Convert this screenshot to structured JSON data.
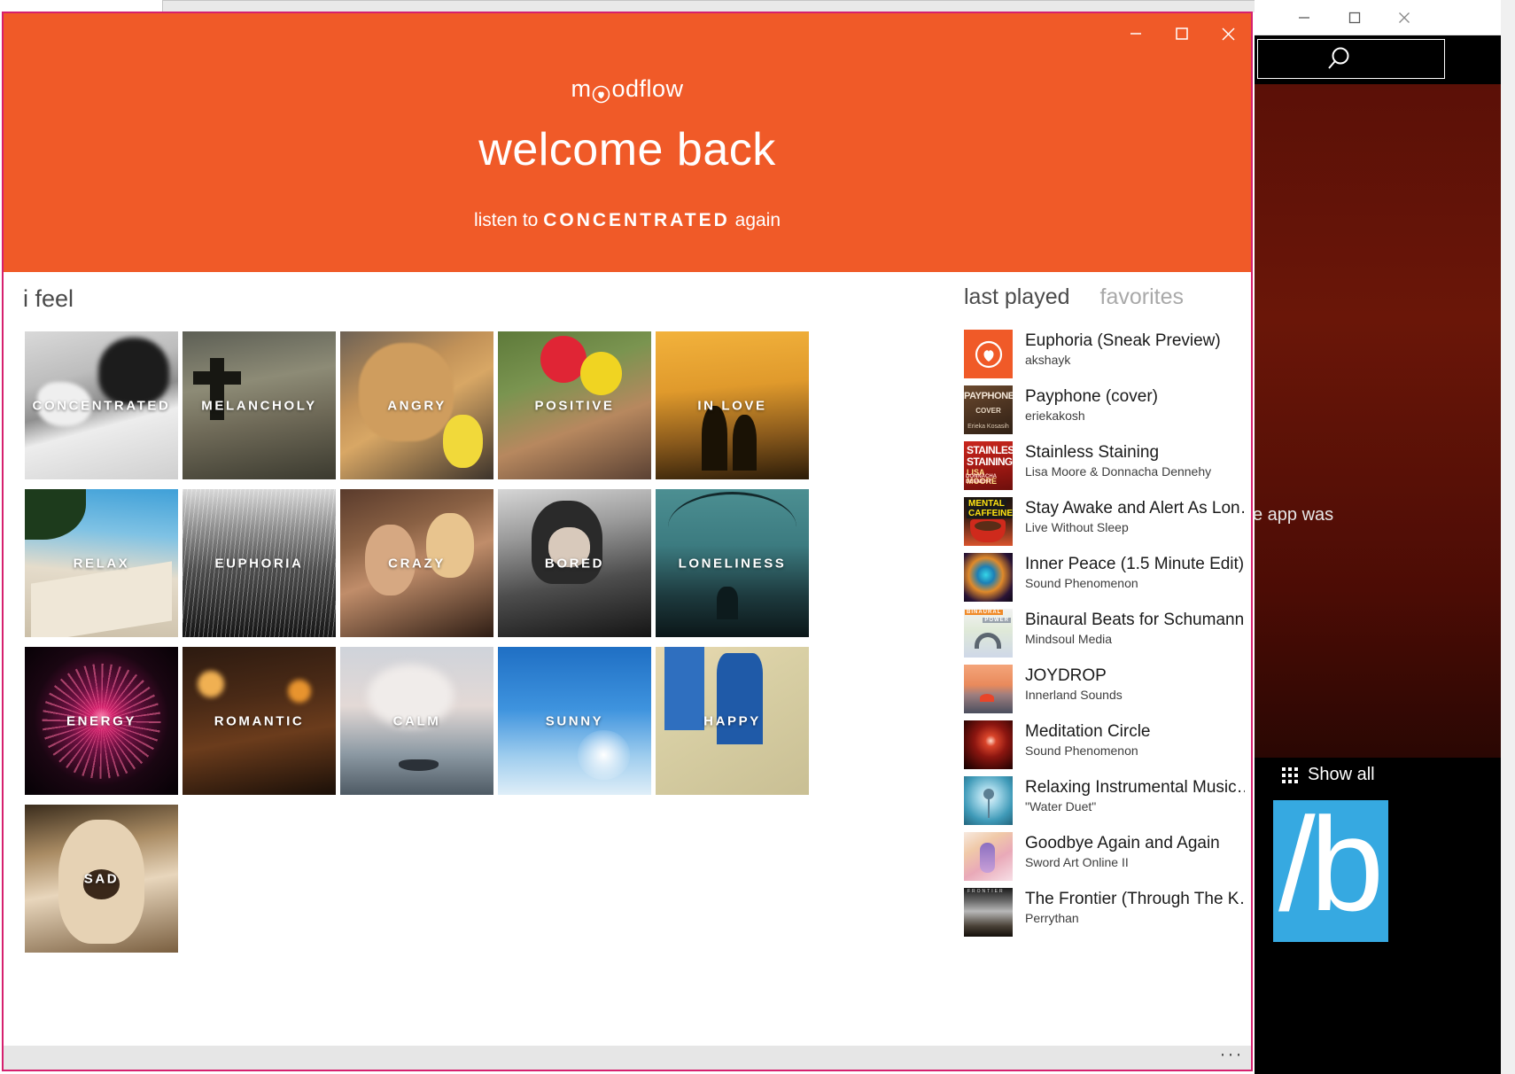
{
  "app": {
    "brand_prefix": "m",
    "brand_suffix": "odflow",
    "brand_icon": "heart-circle-icon",
    "accent_color": "#f05a28",
    "window_border_color": "#d6206e",
    "hero_title": "welcome back",
    "hero_sub_prefix": "listen to",
    "hero_sub_strong": "CONCENTRATED",
    "hero_sub_suffix": "again"
  },
  "window_controls": {
    "minimize": "minimize-icon",
    "maximize": "maximize-icon",
    "close": "close-icon"
  },
  "main": {
    "section_title": "i feel",
    "moods": [
      {
        "label": "CONCENTRATED",
        "art": "a-concentrated"
      },
      {
        "label": "MELANCHOLY",
        "art": "a-melancholy"
      },
      {
        "label": "ANGRY",
        "art": "a-angry"
      },
      {
        "label": "POSITIVE",
        "art": "a-positive"
      },
      {
        "label": "IN LOVE",
        "art": "a-inlove"
      },
      {
        "label": "RELAX",
        "art": "a-relax"
      },
      {
        "label": "EUPHORIA",
        "art": "a-euphoria"
      },
      {
        "label": "CRAZY",
        "art": "a-crazy"
      },
      {
        "label": "BORED",
        "art": "a-bored"
      },
      {
        "label": "LONELINESS",
        "art": "a-loneliness"
      },
      {
        "label": "ENERGY",
        "art": "a-energy"
      },
      {
        "label": "ROMANTIC",
        "art": "a-romantic"
      },
      {
        "label": "CALM",
        "art": "a-calm"
      },
      {
        "label": "SUNNY",
        "art": "a-sunny"
      },
      {
        "label": "HAPPY",
        "art": "a-happy"
      },
      {
        "label": "SAD",
        "art": "a-sad"
      }
    ]
  },
  "sidebar": {
    "tabs": [
      {
        "label": "last played",
        "active": true
      },
      {
        "label": "favorites",
        "active": false
      }
    ],
    "tracks": [
      {
        "title": "Euphoria (Sneak Preview)",
        "artist": "akshayk",
        "cover": "cv-euphoria"
      },
      {
        "title": "Payphone (cover)",
        "artist": "eriekakosh",
        "cover": "cv-payphone"
      },
      {
        "title": "Stainless Staining",
        "artist": "Lisa Moore & Donnacha Dennehy",
        "cover": "cv-stainless"
      },
      {
        "title": "Stay Awake and Alert As Lon…",
        "artist": "Live Without Sleep",
        "cover": "cv-caffeine"
      },
      {
        "title": "Inner Peace (1.5 Minute Edit)",
        "artist": "Sound Phenomenon",
        "cover": "cv-innerpeace"
      },
      {
        "title": "Binaural Beats for Schumann…",
        "artist": "Mindsoul Media",
        "cover": "cv-binaural"
      },
      {
        "title": "JOYDROP",
        "artist": "Innerland Sounds",
        "cover": "cv-joydrop"
      },
      {
        "title": "Meditation Circle",
        "artist": "Sound Phenomenon",
        "cover": "cv-meditation"
      },
      {
        "title": "Relaxing Instrumental Music…",
        "artist": "\"Water Duet\"",
        "cover": "cv-relaxing"
      },
      {
        "title": "Goodbye Again and Again",
        "artist": "Sword Art Online II",
        "cover": "cv-goodbye"
      },
      {
        "title": "The Frontier (Through The K…",
        "artist": "Perrythan",
        "cover": "cv-frontier"
      }
    ]
  },
  "app_bar": {
    "more_label": "···",
    "more_icon": "ellipsis-icon"
  },
  "background": {
    "search_icon": "search-icon",
    "app_text": "e app was",
    "show_all_label": "Show all",
    "show_all_icon": "grid-icon",
    "tile_text": "/b",
    "tile_color": "#36a9e1"
  }
}
